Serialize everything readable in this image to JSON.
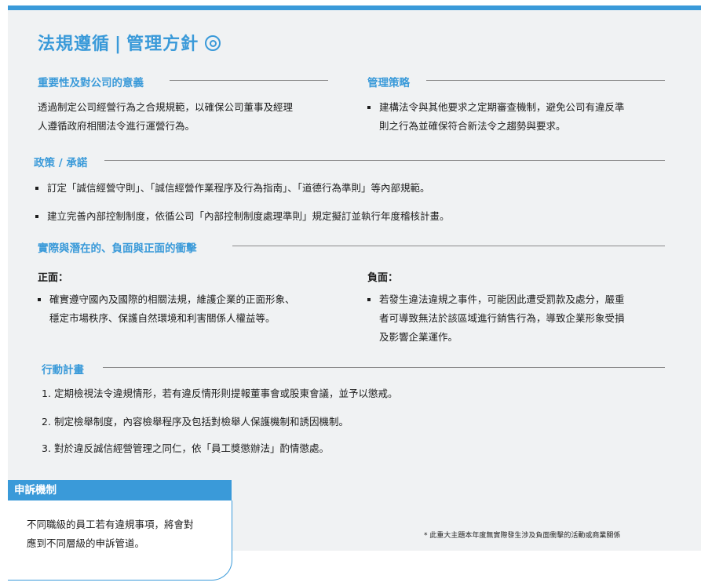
{
  "header": {
    "title_main": "法規遵循",
    "title_sep": "|",
    "title_sub": "管理方針"
  },
  "importance": {
    "heading": "重要性及對公司的意義",
    "lines": [
      "透過制定公司經營行為之合規規範，以確保公司董事及經理",
      "人遵循政府相關法令進行運營行為。"
    ]
  },
  "strategy": {
    "heading": "管理策略",
    "lines": [
      "建構法令與其他要求之定期審查機制，避免公司有違反準",
      "則之行為並確保符合新法令之趨勢與要求。"
    ]
  },
  "policy": {
    "heading": "政策 / 承諾",
    "items": [
      "訂定「誠信經營守則」、「誠信經營作業程序及行為指南」、「道德行為準則」等內部規範。",
      "建立完善內部控制制度，依循公司「內部控制制度處理準則」規定擬訂並執行年度稽核計畫。"
    ]
  },
  "impact": {
    "heading": "實際與潛在的、負面與正面的衝擊",
    "positive": {
      "label": "正面：",
      "lines": [
        "確實遵守國內及國際的相關法規，維護企業的正面形象、",
        "穩定市場秩序、保護自然環境和利害關係人權益等。"
      ]
    },
    "negative": {
      "label": "負面：",
      "lines": [
        "若發生違法違規之事件，可能因此遭受罰款及處分，嚴重",
        "者可導致無法於該區域進行銷售行為，導致企業形象受損",
        "及影響企業運作。"
      ]
    }
  },
  "action": {
    "heading": "行動計畫",
    "items": [
      {
        "num": "1.",
        "text": "定期檢視法令違規情形，若有違反情形則提報董事會或股東會議，並予以懲戒。"
      },
      {
        "num": "2.",
        "text": "制定檢舉制度，內容檢舉程序及包括對檢舉人保護機制和誘因機制。"
      },
      {
        "num": "3.",
        "text": "對於違反誠信經營管理之同仁，依「員工獎懲辦法」酌情懲處。"
      }
    ]
  },
  "complaint": {
    "heading": "申訴機制",
    "lines": [
      "不同職級的員工若有違規事項，將會對",
      "應到不同層級的申訴管道。"
    ]
  },
  "footnote": "* 此重大主題本年度無實際發生涉及負面衝擊的活動或商業關係",
  "colors": {
    "accent": "#3a9ad9",
    "panel": "#f0f2f3",
    "text": "#1e1e1e"
  }
}
